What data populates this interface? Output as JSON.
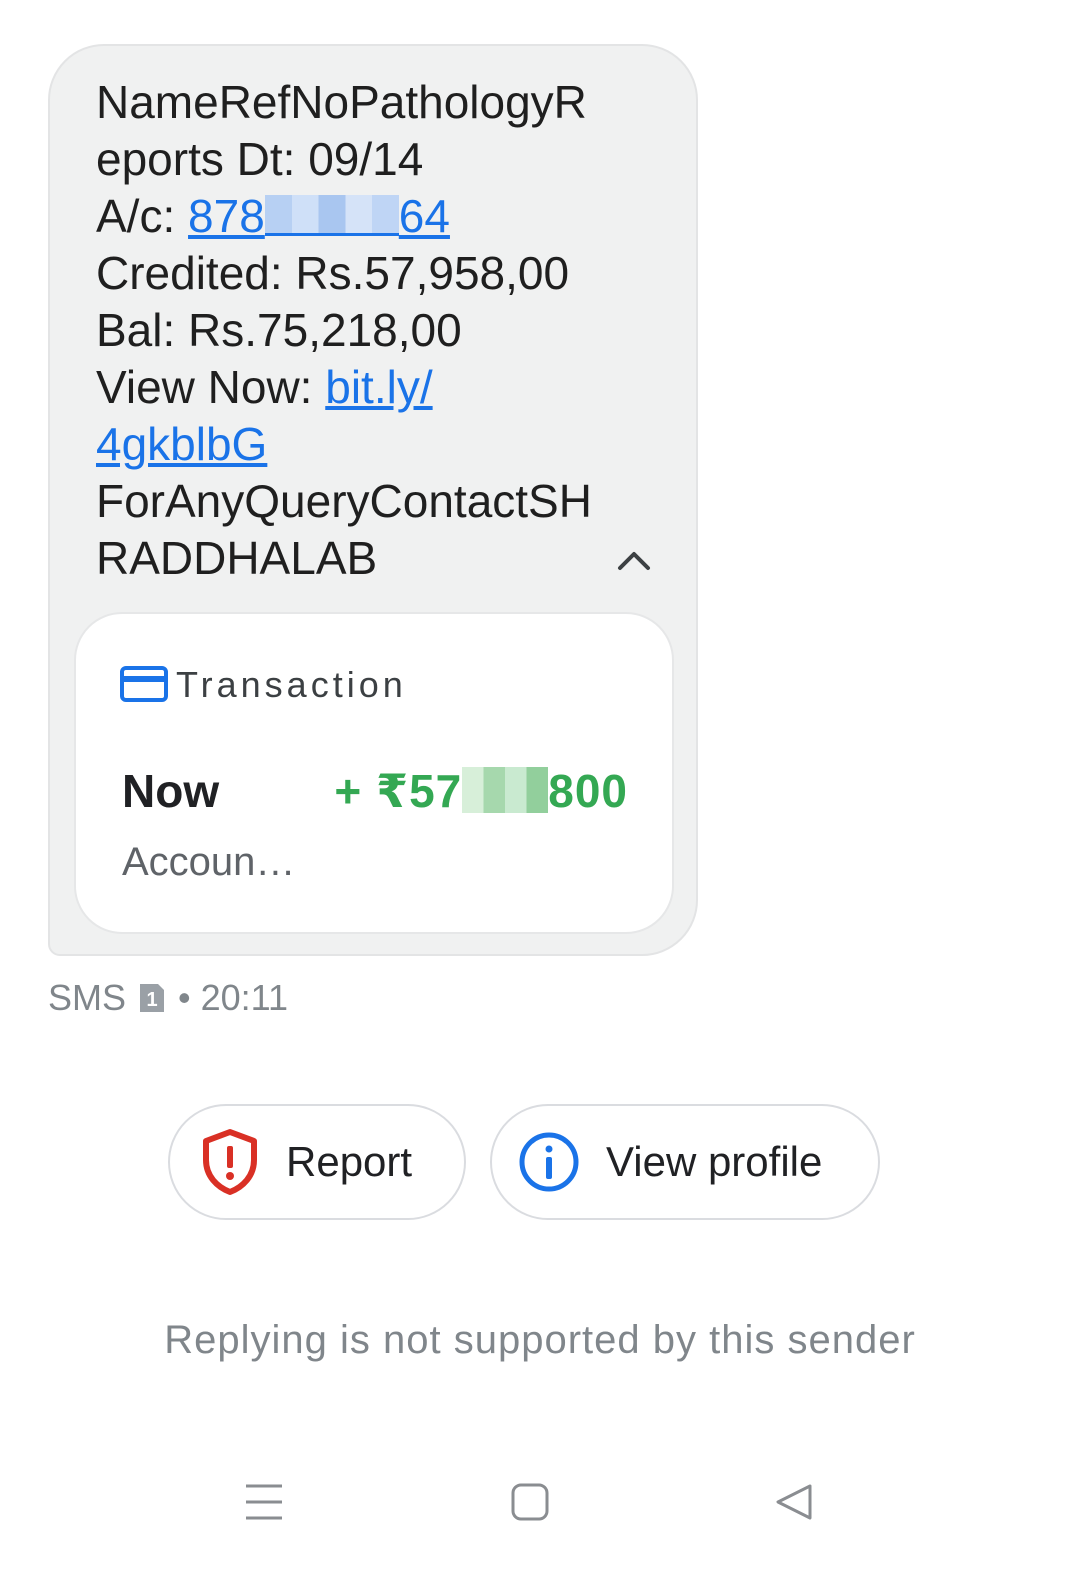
{
  "message": {
    "line1": "NameRefNoPathologyR",
    "line2": "eports Dt: 09/14",
    "acct_prefix": "A/c: ",
    "acct_start": "878",
    "acct_end": "64",
    "credited": "Credited: Rs.57,958,00",
    "balance": "Bal: Rs.75,218,00",
    "view_prefix": "View Now: ",
    "link_part1": "bit.ly/",
    "link_part2": "4gkblbG",
    "query_line1": "ForAnyQueryContactSH",
    "query_line2": "RADDHALAB"
  },
  "card": {
    "icon": "credit-card-icon",
    "title": "Transaction",
    "when": "Now",
    "amount_prefix": "+ ₹57",
    "amount_suffix": "800",
    "subtitle": "Accoun…"
  },
  "meta": {
    "channel": "SMS",
    "sim": "1",
    "time": "• 20:11"
  },
  "actions": {
    "report_label": "Report",
    "view_profile_label": "View profile"
  },
  "footer": {
    "reply_note": "Replying is not supported by this sender"
  },
  "colors": {
    "link": "#1a73e8",
    "credit": "#34a853",
    "report_icon": "#d93025",
    "bubble_bg": "#f0f1f1"
  }
}
